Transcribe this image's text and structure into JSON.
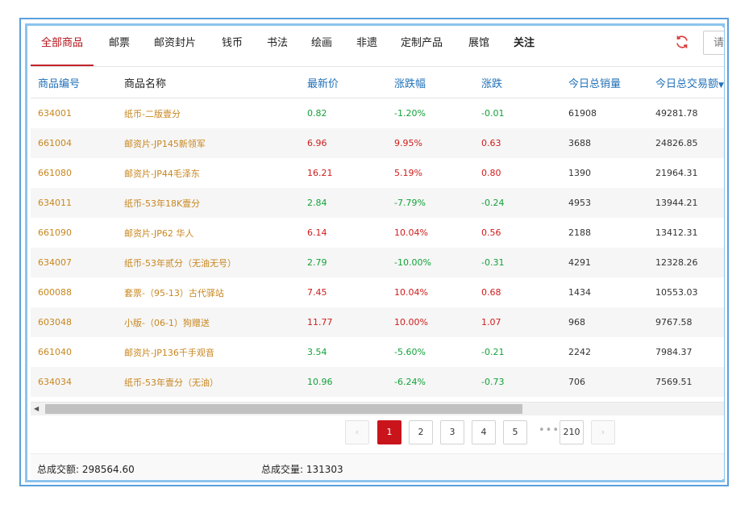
{
  "tabs": [
    {
      "label": "全部商品"
    },
    {
      "label": "邮票"
    },
    {
      "label": "邮资封片"
    },
    {
      "label": "钱币"
    },
    {
      "label": "书法"
    },
    {
      "label": "绘画"
    },
    {
      "label": "非遗"
    },
    {
      "label": "定制产品"
    },
    {
      "label": "展馆"
    },
    {
      "label": "关注"
    }
  ],
  "search": {
    "placeholder": "请"
  },
  "columns": [
    "商品编号",
    "商品名称",
    "最新价",
    "涨跌幅",
    "涨跌",
    "今日总销量",
    "今日总交易额"
  ],
  "sort_indicator": "▼",
  "rows": [
    {
      "code": "634001",
      "name": "纸币-二版壹分",
      "price": "0.82",
      "pct": "-1.20%",
      "change": "-0.01",
      "volume": "61908",
      "amount": "49281.78"
    },
    {
      "code": "661004",
      "name": "邮资片-JP145新领军",
      "price": "6.96",
      "pct": "9.95%",
      "change": "0.63",
      "volume": "3688",
      "amount": "24826.85"
    },
    {
      "code": "661080",
      "name": "邮资片-JP44毛泽东",
      "price": "16.21",
      "pct": "5.19%",
      "change": "0.80",
      "volume": "1390",
      "amount": "21964.31"
    },
    {
      "code": "634011",
      "name": "纸币-53年18K壹分",
      "price": "2.84",
      "pct": "-7.79%",
      "change": "-0.24",
      "volume": "4953",
      "amount": "13944.21"
    },
    {
      "code": "661090",
      "name": "邮资片-JP62 华人",
      "price": "6.14",
      "pct": "10.04%",
      "change": "0.56",
      "volume": "2188",
      "amount": "13412.31"
    },
    {
      "code": "634007",
      "name": "纸币-53年贰分（无油无号）",
      "price": "2.79",
      "pct": "-10.00%",
      "change": "-0.31",
      "volume": "4291",
      "amount": "12328.26"
    },
    {
      "code": "600088",
      "name": "套票-（95-13）古代驿站",
      "price": "7.45",
      "pct": "10.04%",
      "change": "0.68",
      "volume": "1434",
      "amount": "10553.03"
    },
    {
      "code": "603048",
      "name": "小版-（06-1）狗赠送",
      "price": "11.77",
      "pct": "10.00%",
      "change": "1.07",
      "volume": "968",
      "amount": "9767.58"
    },
    {
      "code": "661040",
      "name": "邮资片-JP136千手观音",
      "price": "3.54",
      "pct": "-5.60%",
      "change": "-0.21",
      "volume": "2242",
      "amount": "7984.37"
    },
    {
      "code": "634034",
      "name": "纸币-53年壹分（无油）",
      "price": "10.96",
      "pct": "-6.24%",
      "change": "-0.73",
      "volume": "706",
      "amount": "7569.51"
    }
  ],
  "pagination": {
    "prev": "‹",
    "next": "›",
    "pages": [
      "1",
      "2",
      "3",
      "4",
      "5"
    ],
    "ellipsis": "•••",
    "last": "210",
    "current": "1"
  },
  "footer": {
    "total_amount_label": "总成交额:",
    "total_amount": "298564.60",
    "total_volume_label": "总成交量:",
    "total_volume": "131303"
  },
  "colors": {
    "accent": "#c9141c",
    "up": "#d01b1b",
    "down": "#12a239",
    "header_text": "#2272b8",
    "code_text": "#c8861e"
  },
  "icons": {
    "refresh": "refresh-icon",
    "scroll_left": "arrow-left-icon"
  }
}
